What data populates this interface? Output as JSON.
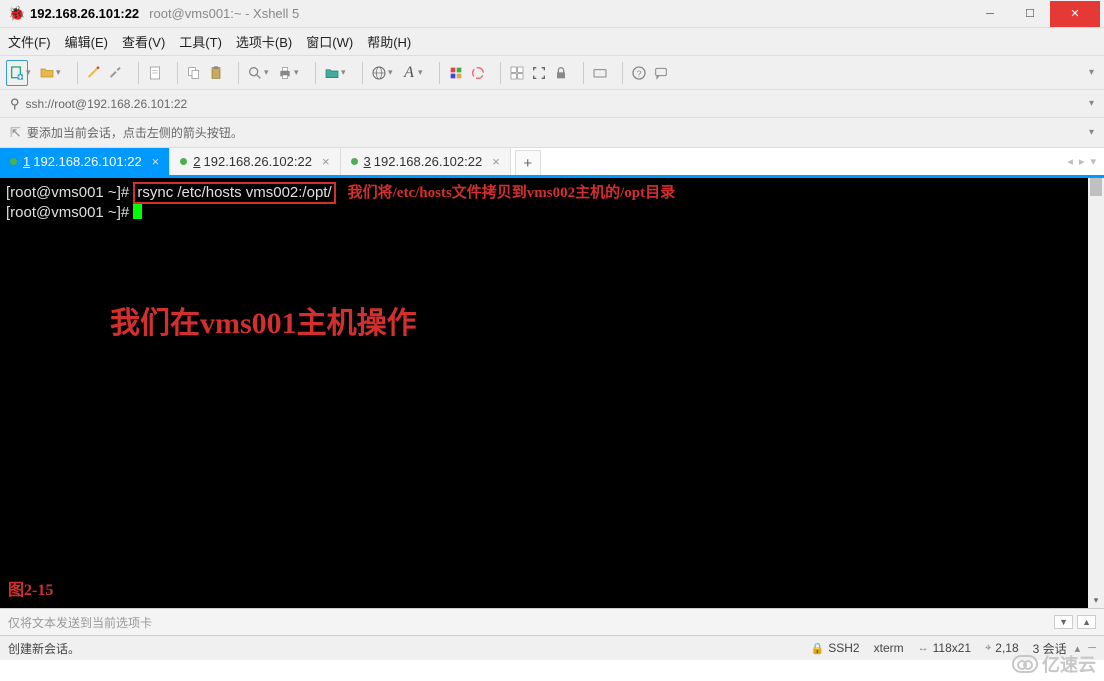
{
  "window": {
    "title_main": "192.168.26.101:22",
    "title_sub": "root@vms001:~ - Xshell 5"
  },
  "menu": {
    "items": [
      "文件(F)",
      "编辑(E)",
      "查看(V)",
      "工具(T)",
      "选项卡(B)",
      "窗口(W)",
      "帮助(H)"
    ]
  },
  "toolbar": {
    "new_file": "new-file-icon",
    "open": "open-folder-icon",
    "reconnect": "reconnect-icon",
    "disconnect": "disconnect-icon",
    "properties": "properties-icon",
    "copy": "copy-icon",
    "paste": "paste-icon",
    "find": "find-icon",
    "print": "print-icon",
    "xftp": "xftp-icon",
    "web": "globe-icon",
    "font": "font-icon",
    "color_scheme": "color-scheme-icon",
    "onedrive": "onedrive-icon",
    "sessions": "sessions-icon",
    "fullscreen": "fullscreen-icon",
    "lock": "lock-icon",
    "keyboard": "keyboard-icon",
    "help": "help-icon",
    "chat": "chat-icon"
  },
  "address": {
    "url": "ssh://root@192.168.26.101:22"
  },
  "hint": {
    "text": "要添加当前会话，点击左侧的箭头按钮。"
  },
  "tabs": {
    "items": [
      {
        "num": "1",
        "label": "192.168.26.101:22",
        "active": true
      },
      {
        "num": "2",
        "label": "192.168.26.102:22",
        "active": false
      },
      {
        "num": "3",
        "label": "192.168.26.102:22",
        "active": false
      }
    ],
    "add": "+"
  },
  "terminal": {
    "line1_prompt": "[root@vms001 ~]# ",
    "line1_cmd": "rsync /etc/hosts vms002:/opt/",
    "line1_annot": "我们将/etc/hosts文件拷贝到vms002主机的/opt目录",
    "line2_prompt": "[root@vms001 ~]# ",
    "big_annot": "我们在vms001主机操作",
    "figure_label": "图2-15"
  },
  "send_bar": {
    "placeholder": "仅将文本发送到当前选项卡"
  },
  "status": {
    "message": "创建新会话。",
    "protocol": "SSH2",
    "term_type": "xterm",
    "size": "118x21",
    "pos": "2,18",
    "sessions": "3 会话"
  },
  "watermark": {
    "text": "亿速云"
  }
}
